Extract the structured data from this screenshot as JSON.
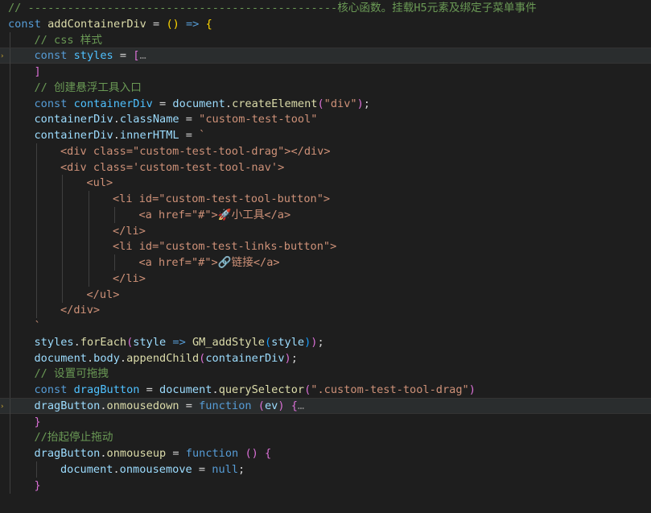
{
  "editor": {
    "lines": [
      {
        "id": 1,
        "tokens": [
          [
            "cm",
            "// -----------------------------------------------核心函数。挂载H5元素及绑定子菜单事件"
          ]
        ]
      },
      {
        "id": 2,
        "tokens": [
          [
            "kw",
            "const"
          ],
          [
            "op",
            " "
          ],
          [
            "fn",
            "addContainerDiv"
          ],
          [
            "op",
            " = "
          ],
          [
            "p1",
            "()"
          ],
          [
            "op",
            " "
          ],
          [
            "kw",
            "=>"
          ],
          [
            "op",
            " "
          ],
          [
            "p1",
            "{"
          ]
        ]
      },
      {
        "id": 3,
        "indent": 1,
        "tokens": [
          [
            "cm",
            "// css 样式"
          ]
        ]
      },
      {
        "id": 4,
        "indent": 1,
        "highlight": true,
        "marker": true,
        "tokens": [
          [
            "kw",
            "const"
          ],
          [
            "op",
            " "
          ],
          [
            "cn",
            "styles"
          ],
          [
            "op",
            " = "
          ],
          [
            "p2",
            "["
          ],
          [
            "el",
            "…"
          ]
        ]
      },
      {
        "id": 5,
        "indent": 1,
        "tokens": [
          [
            "p2",
            "]"
          ]
        ]
      },
      {
        "id": 6,
        "indent": 1,
        "tokens": [
          [
            "cm",
            "// 创建悬浮工具入口"
          ]
        ]
      },
      {
        "id": 7,
        "indent": 1,
        "tokens": [
          [
            "kw",
            "const"
          ],
          [
            "op",
            " "
          ],
          [
            "cn",
            "containerDiv"
          ],
          [
            "op",
            " = "
          ],
          [
            "vr",
            "document"
          ],
          [
            "op",
            "."
          ],
          [
            "fn",
            "createElement"
          ],
          [
            "p2",
            "("
          ],
          [
            "st",
            "\"div\""
          ],
          [
            "p2",
            ")"
          ],
          [
            "op",
            ";"
          ]
        ]
      },
      {
        "id": 8,
        "indent": 1,
        "tokens": [
          [
            "vr",
            "containerDiv"
          ],
          [
            "op",
            "."
          ],
          [
            "vr",
            "className"
          ],
          [
            "op",
            " = "
          ],
          [
            "st",
            "\"custom-test-tool\""
          ]
        ]
      },
      {
        "id": 9,
        "indent": 1,
        "tokens": [
          [
            "vr",
            "containerDiv"
          ],
          [
            "op",
            "."
          ],
          [
            "vr",
            "innerHTML"
          ],
          [
            "op",
            " = "
          ],
          [
            "st",
            "`"
          ]
        ]
      },
      {
        "id": 10,
        "indent": 2,
        "tokens": [
          [
            "st",
            "<div class=\"custom-test-tool-drag\"></div>"
          ]
        ]
      },
      {
        "id": 11,
        "indent": 2,
        "tokens": [
          [
            "st",
            "<div class='custom-test-tool-nav'>"
          ]
        ]
      },
      {
        "id": 12,
        "indent": 3,
        "tokens": [
          [
            "st",
            "<ul>"
          ]
        ]
      },
      {
        "id": 13,
        "indent": 4,
        "tokens": [
          [
            "st",
            "<li id=\"custom-test-tool-button\">"
          ]
        ]
      },
      {
        "id": 14,
        "indent": 5,
        "tokens": [
          [
            "st",
            "<a href=\"#\">🚀小工具</a>"
          ]
        ]
      },
      {
        "id": 15,
        "indent": 4,
        "tokens": [
          [
            "st",
            "</li>"
          ]
        ]
      },
      {
        "id": 16,
        "indent": 4,
        "tokens": [
          [
            "st",
            "<li id=\"custom-test-links-button\">"
          ]
        ]
      },
      {
        "id": 17,
        "indent": 5,
        "tokens": [
          [
            "st",
            "<a href=\"#\">🔗链接</a>"
          ]
        ]
      },
      {
        "id": 18,
        "indent": 4,
        "tokens": [
          [
            "st",
            "</li>"
          ]
        ]
      },
      {
        "id": 19,
        "indent": 3,
        "tokens": [
          [
            "st",
            "</ul>"
          ]
        ]
      },
      {
        "id": 20,
        "indent": 2,
        "tokens": [
          [
            "st",
            "</div>"
          ]
        ]
      },
      {
        "id": 21,
        "indent": 1,
        "tokens": [
          [
            "st",
            "`"
          ]
        ]
      },
      {
        "id": 22,
        "indent": 1,
        "tokens": [
          [
            "vr",
            "styles"
          ],
          [
            "op",
            "."
          ],
          [
            "fn",
            "forEach"
          ],
          [
            "p2",
            "("
          ],
          [
            "vr",
            "style"
          ],
          [
            "op",
            " "
          ],
          [
            "kw",
            "=>"
          ],
          [
            "op",
            " "
          ],
          [
            "fn",
            "GM_addStyle"
          ],
          [
            "p3",
            "("
          ],
          [
            "vr",
            "style"
          ],
          [
            "p3",
            ")"
          ],
          [
            "p2",
            ")"
          ],
          [
            "op",
            ";"
          ]
        ]
      },
      {
        "id": 23,
        "indent": 1,
        "tokens": [
          [
            "vr",
            "document"
          ],
          [
            "op",
            "."
          ],
          [
            "vr",
            "body"
          ],
          [
            "op",
            "."
          ],
          [
            "fn",
            "appendChild"
          ],
          [
            "p2",
            "("
          ],
          [
            "vr",
            "containerDiv"
          ],
          [
            "p2",
            ")"
          ],
          [
            "op",
            ";"
          ]
        ]
      },
      {
        "id": 24,
        "indent": 1,
        "tokens": [
          [
            "cm",
            "// 设置可拖拽"
          ]
        ]
      },
      {
        "id": 25,
        "indent": 1,
        "tokens": [
          [
            "kw",
            "const"
          ],
          [
            "op",
            " "
          ],
          [
            "cn",
            "dragButton"
          ],
          [
            "op",
            " = "
          ],
          [
            "vr",
            "document"
          ],
          [
            "op",
            "."
          ],
          [
            "fn",
            "querySelector"
          ],
          [
            "p2",
            "("
          ],
          [
            "st",
            "\".custom-test-tool-drag\""
          ],
          [
            "p2",
            ")"
          ]
        ]
      },
      {
        "id": 26,
        "indent": 1,
        "highlight": true,
        "marker": true,
        "tokens": [
          [
            "vr",
            "dragButton"
          ],
          [
            "op",
            "."
          ],
          [
            "fn",
            "onmousedown"
          ],
          [
            "op",
            " = "
          ],
          [
            "kw",
            "function"
          ],
          [
            "op",
            " "
          ],
          [
            "p2",
            "("
          ],
          [
            "vr",
            "ev"
          ],
          [
            "p2",
            ")"
          ],
          [
            "op",
            " "
          ],
          [
            "p2",
            "{"
          ],
          [
            "el",
            "…"
          ]
        ]
      },
      {
        "id": 27,
        "indent": 1,
        "tokens": [
          [
            "p2",
            "}"
          ]
        ]
      },
      {
        "id": 28,
        "indent": 1,
        "tokens": [
          [
            "cm",
            "//抬起停止拖动"
          ]
        ]
      },
      {
        "id": 29,
        "indent": 1,
        "tokens": [
          [
            "vr",
            "dragButton"
          ],
          [
            "op",
            "."
          ],
          [
            "fn",
            "onmouseup"
          ],
          [
            "op",
            " = "
          ],
          [
            "kw",
            "function"
          ],
          [
            "op",
            " "
          ],
          [
            "p2",
            "()"
          ],
          [
            "op",
            " "
          ],
          [
            "p2",
            "{"
          ]
        ]
      },
      {
        "id": 30,
        "indent": 2,
        "tokens": [
          [
            "vr",
            "document"
          ],
          [
            "op",
            "."
          ],
          [
            "vr",
            "onmousemove"
          ],
          [
            "op",
            " = "
          ],
          [
            "kw",
            "null"
          ],
          [
            "op",
            ";"
          ]
        ]
      },
      {
        "id": 31,
        "indent": 1,
        "tokens": [
          [
            "p2",
            "}"
          ]
        ]
      }
    ]
  }
}
